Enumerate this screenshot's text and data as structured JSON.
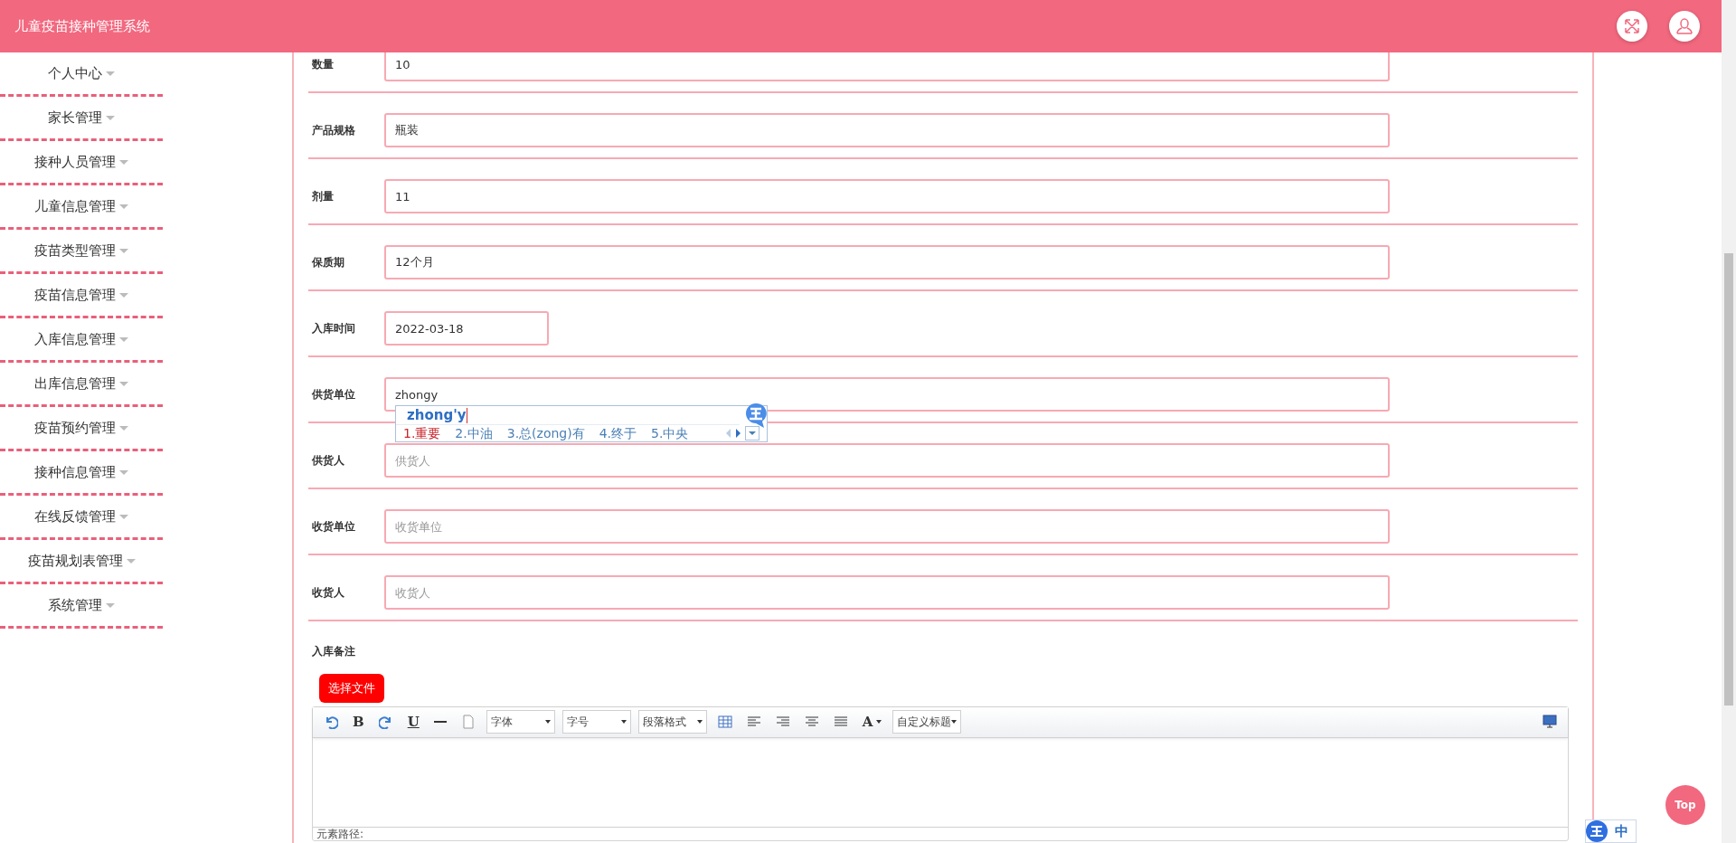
{
  "header": {
    "title": "儿童疫苗接种管理系统"
  },
  "sidebar": {
    "items": [
      {
        "label": "个人中心"
      },
      {
        "label": "家长管理"
      },
      {
        "label": "接种人员管理"
      },
      {
        "label": "儿童信息管理"
      },
      {
        "label": "疫苗类型管理"
      },
      {
        "label": "疫苗信息管理"
      },
      {
        "label": "入库信息管理"
      },
      {
        "label": "出库信息管理"
      },
      {
        "label": "疫苗预约管理"
      },
      {
        "label": "接种信息管理"
      },
      {
        "label": "在线反馈管理"
      },
      {
        "label": "疫苗规划表管理"
      },
      {
        "label": "系统管理"
      }
    ]
  },
  "form": {
    "fields": [
      {
        "label": "数量",
        "kind": "text",
        "value": "10"
      },
      {
        "label": "产品规格",
        "kind": "text",
        "value": "瓶装"
      },
      {
        "label": "剂量",
        "kind": "text",
        "value": "11"
      },
      {
        "label": "保质期",
        "kind": "text",
        "value": "12个月"
      },
      {
        "label": "入库时间",
        "kind": "date",
        "value": "2022-03-18"
      },
      {
        "label": "供货单位",
        "kind": "text",
        "value": "zhongy",
        "ime": {
          "composition": "zhong'y",
          "candidates": [
            {
              "label": "1.重要",
              "selected": true
            },
            {
              "label": "2.中油",
              "selected": false
            },
            {
              "label": "3.总(zong)有",
              "selected": false
            },
            {
              "label": "4.终于",
              "selected": false
            },
            {
              "label": "5.中央",
              "selected": false
            }
          ]
        }
      },
      {
        "label": "供货人",
        "kind": "text",
        "placeholder": "供货人"
      },
      {
        "label": "收货单位",
        "kind": "text",
        "placeholder": "收货单位"
      },
      {
        "label": "收货人",
        "kind": "text",
        "placeholder": "收货人"
      }
    ]
  },
  "remarks": {
    "label": "入库备注",
    "upload_button": "选择文件",
    "editor": {
      "toolbar": [
        {
          "kind": "undo"
        },
        {
          "kind": "bold",
          "label": "B"
        },
        {
          "kind": "redo"
        },
        {
          "kind": "underline",
          "label": "U"
        },
        {
          "kind": "rule"
        },
        {
          "kind": "page"
        },
        {
          "kind": "select",
          "label": "字体"
        },
        {
          "kind": "select",
          "label": "字号"
        },
        {
          "kind": "select",
          "label": "段落格式"
        },
        {
          "kind": "table"
        },
        {
          "kind": "align-left"
        },
        {
          "kind": "align-right"
        },
        {
          "kind": "align-center"
        },
        {
          "kind": "justify"
        },
        {
          "kind": "color",
          "label": "A"
        },
        {
          "kind": "select",
          "label": "自定义标题"
        }
      ],
      "path_label": "元素路径:"
    }
  },
  "top_button": "Top",
  "ime_bar": {
    "mode": "中"
  }
}
